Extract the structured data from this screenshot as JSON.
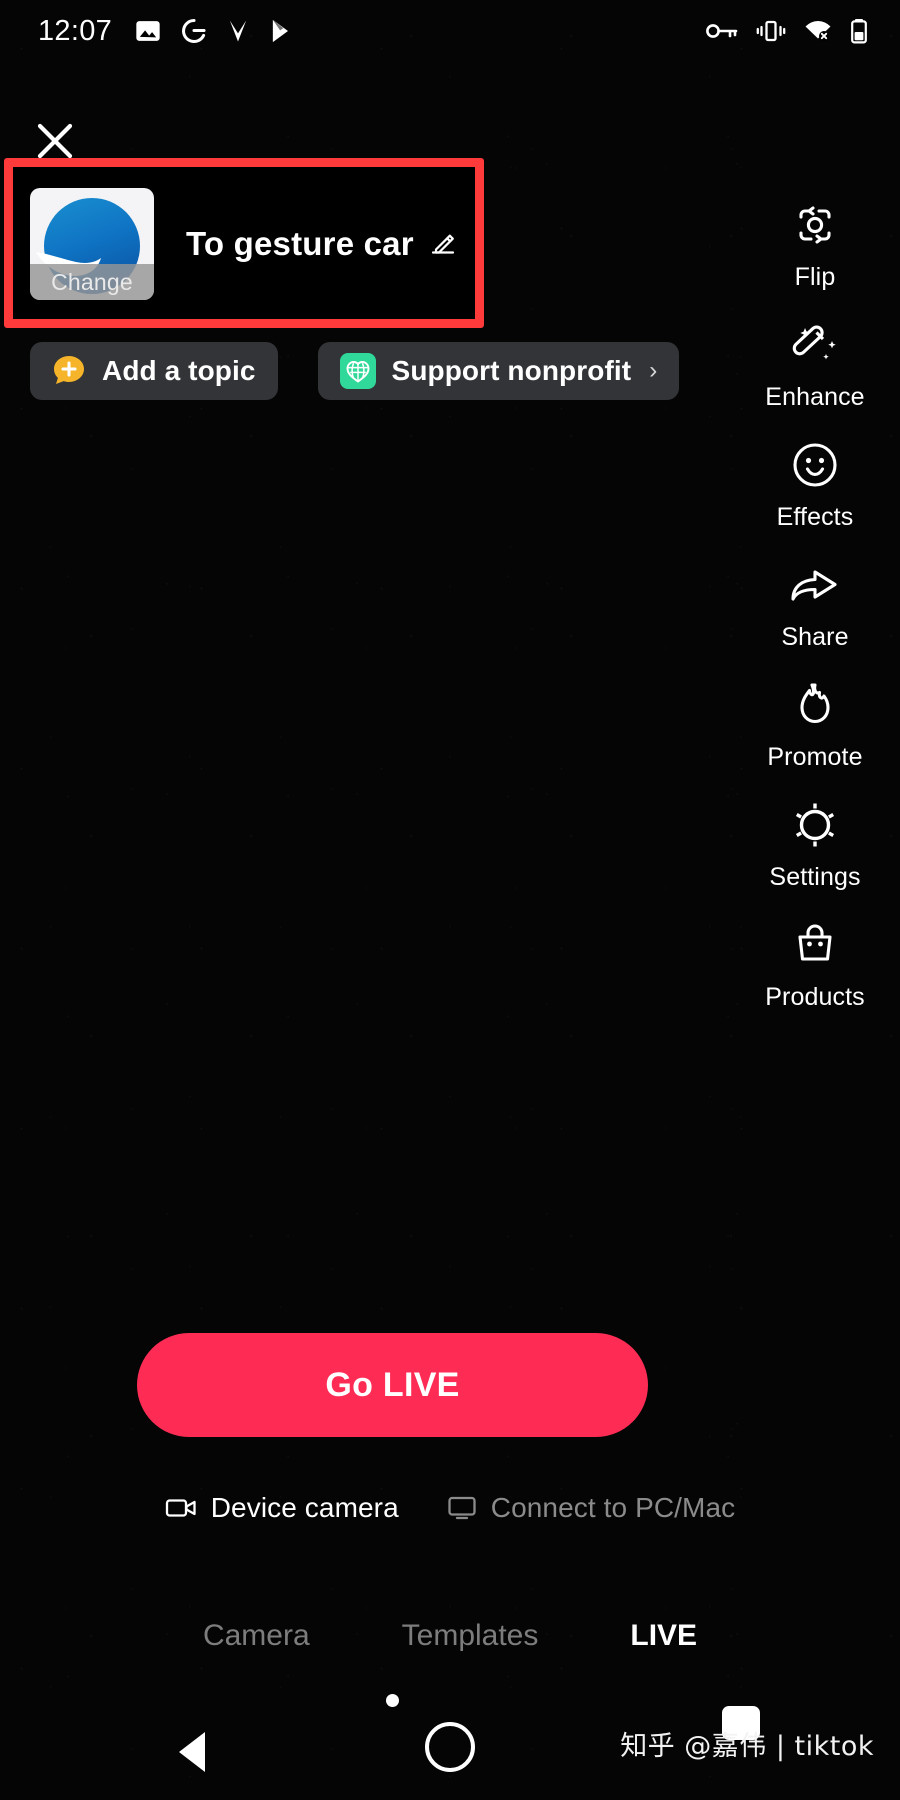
{
  "statusbar": {
    "clock": "12:07",
    "left_icons": [
      "photos-icon",
      "google-icon",
      "v-app-icon",
      "play-store-icon"
    ],
    "right_icons": [
      "vpn-key-icon",
      "vibrate-icon",
      "wifi-off-icon",
      "battery-icon"
    ]
  },
  "header": {
    "close_icon": "close-icon"
  },
  "title_card": {
    "thumbnail_icon": "live-cover-thumbnail",
    "change_label": "Change",
    "title": "To gesture car",
    "edit_icon": "pencil-edit-icon"
  },
  "pills": [
    {
      "icon": "add-topic-bubble-icon",
      "label": "Add a topic",
      "chevron": "",
      "accent": "#F5B429"
    },
    {
      "icon": "nonprofit-globe-heart-icon",
      "label": "Support nonprofit",
      "chevron": "›",
      "accent": "#30D899"
    }
  ],
  "rail": [
    {
      "icon": "camera-flip-icon",
      "label": "Flip"
    },
    {
      "icon": "magic-wand-enhance-icon",
      "label": "Enhance"
    },
    {
      "icon": "smiley-effects-icon",
      "label": "Effects"
    },
    {
      "icon": "share-arrow-icon",
      "label": "Share"
    },
    {
      "icon": "flame-promote-icon",
      "label": "Promote"
    },
    {
      "icon": "gear-settings-icon",
      "label": "Settings"
    },
    {
      "icon": "shopping-bag-products-icon",
      "label": "Products"
    }
  ],
  "go_live": {
    "label": "Go LIVE",
    "color": "#FE2C55"
  },
  "source": {
    "device": {
      "icon": "video-camera-icon",
      "label": "Device camera"
    },
    "pc": {
      "icon": "monitor-icon",
      "label": "Connect to PC/Mac"
    }
  },
  "tabs": [
    {
      "label": "Camera",
      "active": false
    },
    {
      "label": "Templates",
      "active": false
    },
    {
      "label": "LIVE",
      "active": true
    }
  ],
  "watermark": {
    "text": "知乎 @嘉伟 | tiktok"
  },
  "navbar": {
    "back_icon": "nav-back-triangle-icon",
    "home_icon": "nav-home-circle-icon"
  }
}
